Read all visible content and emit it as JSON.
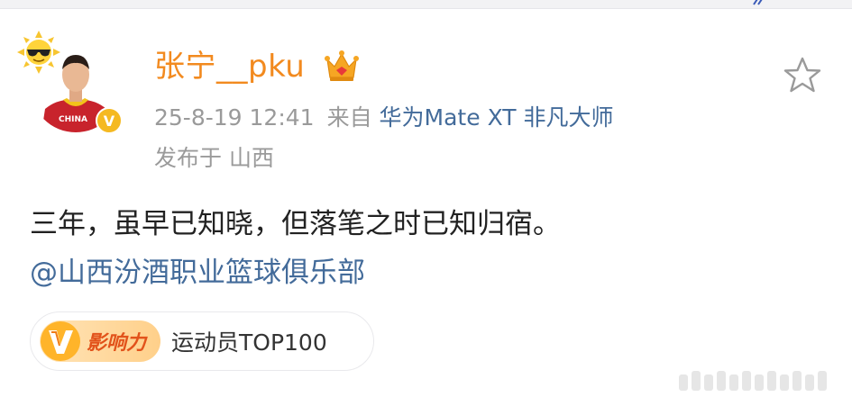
{
  "post": {
    "username": "张宁__pku",
    "timestamp": "25-8-19 12:41",
    "source_prefix": "来自",
    "device": "华为Mate XT 非凡大师",
    "location": "发布于 山西",
    "content_line1": "三年，虽早已知晓，但落笔之时已知归宿。",
    "mention": "@山西汾酒职业篮球俱乐部",
    "influence_label": "影响力",
    "influence_rank": "运动员TOP100"
  },
  "avatar": {
    "jersey_text": "CHINA",
    "verified_mark": "V"
  },
  "icons": {
    "favorite": "star-icon",
    "verified": "verified-badge-icon",
    "crown": "crown-icon",
    "sun": "sunglasses-sun-icon",
    "influence": "v-influence-icon"
  },
  "colors": {
    "username": "#f28a1f",
    "link": "#436b9a",
    "meta": "#9a9a9a",
    "verified": "#f5b921",
    "influence_text": "#e2531b"
  }
}
